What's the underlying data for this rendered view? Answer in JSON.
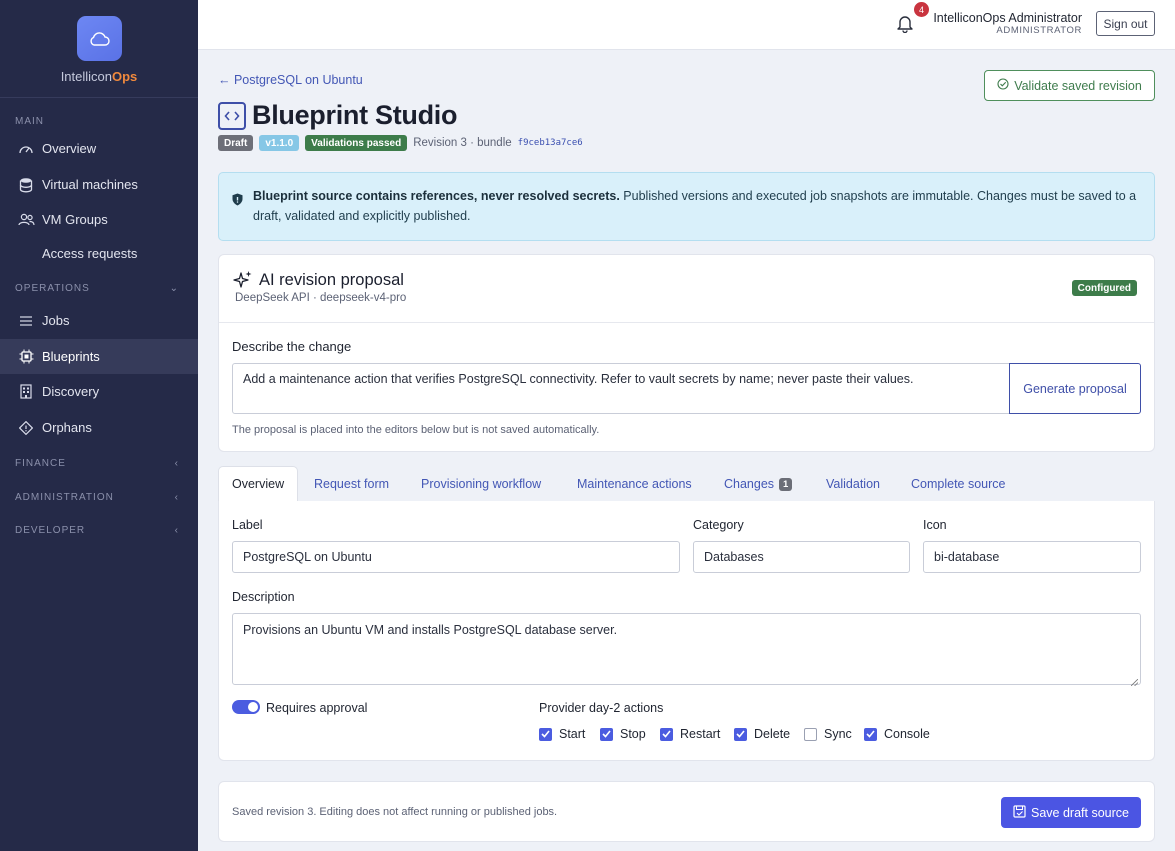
{
  "brand": {
    "name_part1": "Intellicon",
    "name_part2": "Ops",
    "logo_icon": "cloud-icon"
  },
  "sidebar": {
    "sections": {
      "main": "MAIN",
      "operations": "OPERATIONS",
      "finance": "FINANCE",
      "administration": "ADMINISTRATION",
      "developer": "DEVELOPER"
    },
    "items": [
      {
        "label": "Overview",
        "icon": "speedometer-icon"
      },
      {
        "label": "Virtual machines",
        "icon": "database-icon"
      },
      {
        "label": "VM Groups",
        "icon": "people-icon"
      },
      {
        "label": "Access requests",
        "icon": ""
      },
      {
        "label": "Jobs",
        "icon": "list-icon"
      },
      {
        "label": "Blueprints",
        "icon": "cpu-icon"
      },
      {
        "label": "Discovery",
        "icon": "building-icon"
      },
      {
        "label": "Orphans",
        "icon": "diamond-icon"
      }
    ],
    "active": "Blueprints"
  },
  "topbar": {
    "notification_count": "4",
    "user_name": "IntelliconOps Administrator",
    "user_role": "ADMINISTRATOR",
    "signout_label": "Sign out"
  },
  "page": {
    "back_link": "← PostgreSQL on Ubuntu",
    "validate_button": "Validate saved revision",
    "title": "Blueprint Studio",
    "badges": {
      "draft": "Draft",
      "version": "v1.1.0",
      "validation": "Validations passed"
    },
    "revision_text": "Revision 3 · bundle",
    "bundle_id": "f9ceb13a7ce6"
  },
  "alert": {
    "bold_text": "Blueprint source contains references, never resolved secrets.",
    "text": " Published versions and executed job snapshots are immutable. Changes must be saved to a draft, validated and explicitly published."
  },
  "ai": {
    "title": "AI revision proposal",
    "subtitle": "DeepSeek API · deepseek-v4-pro",
    "status_badge": "Configured",
    "describe_label": "Describe the change",
    "describe_value": "Add a maintenance action that verifies PostgreSQL connectivity. Refer to vault secrets by name; never paste their values.",
    "generate_button": "Generate proposal",
    "help_text": "The proposal is placed into the editors below but is not saved automatically."
  },
  "tabs": [
    {
      "label": "Overview"
    },
    {
      "label": "Request form"
    },
    {
      "label": "Provisioning workflow"
    },
    {
      "label": "Maintenance actions"
    },
    {
      "label": "Changes",
      "count": "1"
    },
    {
      "label": "Validation"
    },
    {
      "label": "Complete source"
    }
  ],
  "form": {
    "label_label": "Label",
    "label_value": "PostgreSQL on Ubuntu",
    "category_label": "Category",
    "category_value": "Databases",
    "icon_label": "Icon",
    "icon_value": "bi-database",
    "description_label": "Description",
    "description_value": "Provisions an Ubuntu VM and installs PostgreSQL database server.",
    "requires_approval_label": "Requires approval",
    "requires_approval": true,
    "actions_label": "Provider day-2 actions",
    "actions": [
      {
        "label": "Start",
        "checked": true
      },
      {
        "label": "Stop",
        "checked": true
      },
      {
        "label": "Restart",
        "checked": true
      },
      {
        "label": "Delete",
        "checked": true
      },
      {
        "label": "Sync",
        "checked": false
      },
      {
        "label": "Console",
        "checked": true
      }
    ]
  },
  "footer": {
    "note": "Saved revision 3. Editing does not affect running or published jobs.",
    "save_button": "Save draft source"
  },
  "colors": {
    "sidebar": "#252a48",
    "accent": "#4b55e3",
    "success": "#3d7c4a",
    "brand_orange": "#f0893d",
    "alert_bg": "#d9f0fa"
  }
}
